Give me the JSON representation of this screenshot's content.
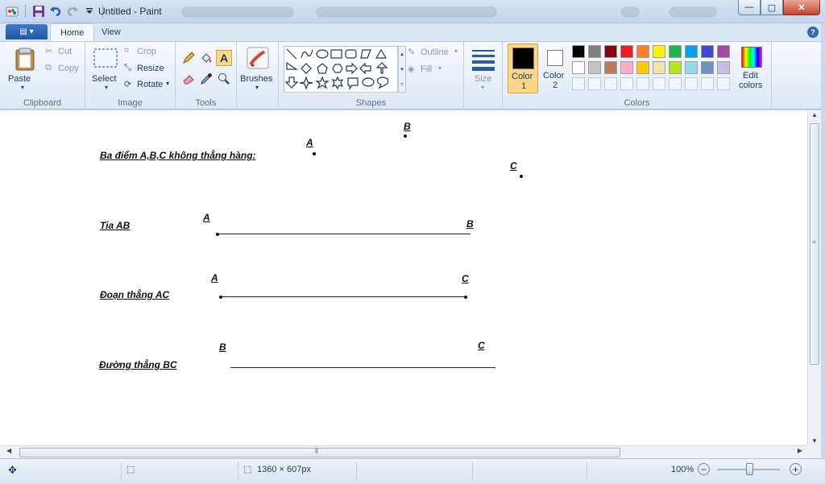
{
  "window": {
    "title": "Untitled - Paint",
    "minimize_glyph": "—",
    "maximize_glyph": "▢",
    "close_glyph": "✕"
  },
  "tabs": {
    "file_glyph": "▤ ▾",
    "home": "Home",
    "view": "View",
    "help_glyph": "?"
  },
  "ribbon": {
    "clipboard": {
      "paste": "Paste",
      "cut": "Cut",
      "copy": "Copy",
      "group": "Clipboard"
    },
    "image": {
      "select": "Select",
      "crop": "Crop",
      "resize": "Resize",
      "rotate": "Rotate",
      "group": "Image"
    },
    "tools": {
      "group": "Tools"
    },
    "brushes": {
      "label": "Brushes"
    },
    "shapes": {
      "outline": "Outline",
      "fill": "Fill",
      "group": "Shapes"
    },
    "size": {
      "label": "Size"
    },
    "colors": {
      "color1_line1": "Color",
      "color1_line2": "1",
      "color2_line1": "Color",
      "color2_line2": "2",
      "edit_line1": "Edit",
      "edit_line2": "colors",
      "group": "Colors",
      "row1": [
        "#000000",
        "#7f7f7f",
        "#880015",
        "#ed1c24",
        "#ff7f27",
        "#fff200",
        "#22b14c",
        "#00a2e8",
        "#3f48cc",
        "#a349a4"
      ],
      "row2": [
        "#ffffff",
        "#c3c3c3",
        "#b97a57",
        "#ffaec9",
        "#ffc90e",
        "#efe4b0",
        "#b5e61d",
        "#99d9ea",
        "#7092be",
        "#c8bfe7"
      ],
      "color1": "#000000",
      "color2": "#ffffff"
    }
  },
  "canvas": {
    "heading1": "Ba điểm A,B,C không thẳng hàng:",
    "heading2": "Tia AB",
    "heading3": "Đoạn thẳng AC",
    "heading4": "Đường thẳng BC",
    "pt_a": "A",
    "pt_b": "B",
    "pt_c": "C"
  },
  "status": {
    "dimensions": "1360 × 607px",
    "zoom": "100%",
    "zoom_out": "−",
    "zoom_in": "+"
  }
}
